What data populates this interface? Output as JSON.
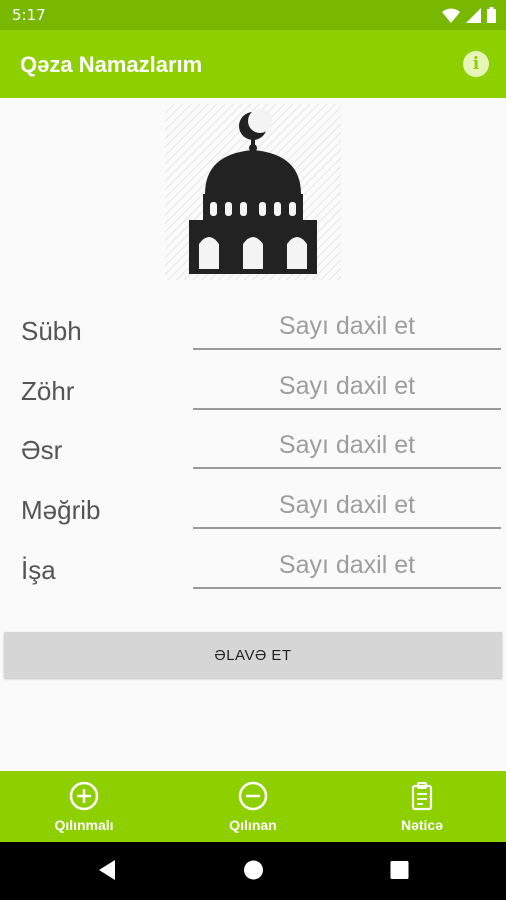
{
  "status_bar": {
    "time": "5:17"
  },
  "app_bar": {
    "title": "Qəza Namazlarım",
    "icon": "info-icon"
  },
  "prayers": [
    {
      "label": "Sübh",
      "placeholder": "Sayı daxil et"
    },
    {
      "label": "Zöhr",
      "placeholder": "Sayı daxil et"
    },
    {
      "label": "Əsr",
      "placeholder": "Sayı daxil et"
    },
    {
      "label": "Məğrib",
      "placeholder": "Sayı daxil et"
    },
    {
      "label": "İşa",
      "placeholder": "Sayı daxil et"
    }
  ],
  "add_button": {
    "label": "ƏLAVƏ ET"
  },
  "bottom_nav": [
    {
      "label": "Qılınmalı",
      "icon": "plus-circle-icon"
    },
    {
      "label": "Qılınan",
      "icon": "minus-circle-icon"
    },
    {
      "label": "Nəticə",
      "icon": "clipboard-icon"
    }
  ],
  "colors": {
    "primary": "#8ecf00",
    "primary_dark": "#78b800",
    "button_bg": "#d6d6d6"
  }
}
